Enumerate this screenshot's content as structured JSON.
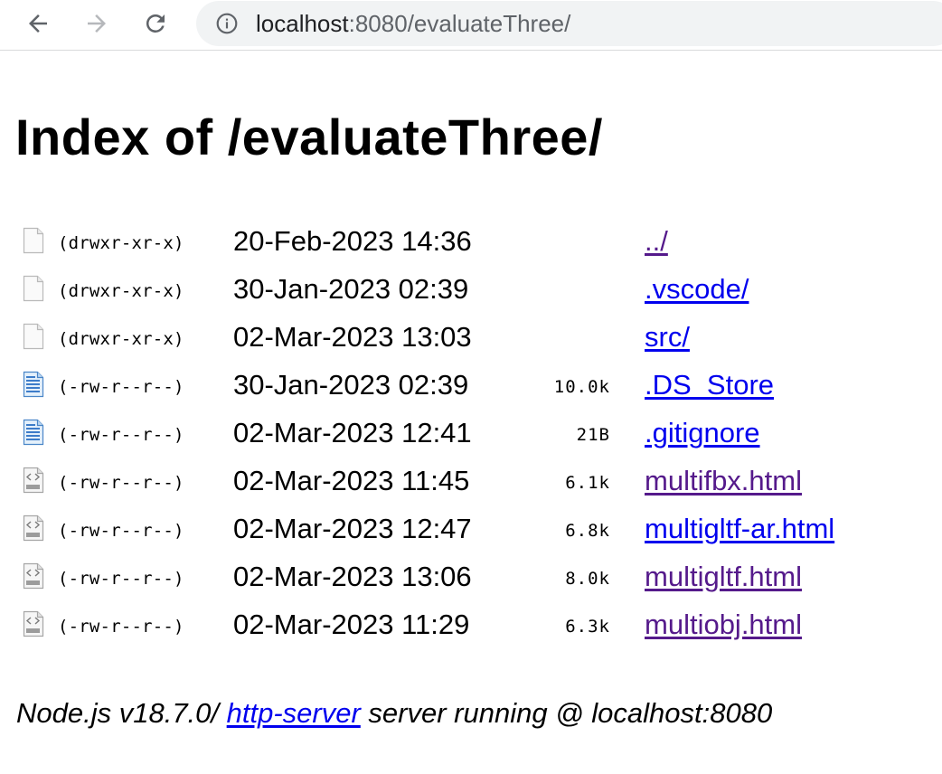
{
  "browser": {
    "url_host": "localhost",
    "url_rest": ":8080/evaluateThree/"
  },
  "page": {
    "title": "Index of /evaluateThree/"
  },
  "entries": [
    {
      "icon": "blank-file-icon",
      "perm": "(drwxr-xr-x)",
      "date": "20-Feb-2023 14:36",
      "size": "",
      "name": "../",
      "visited": true
    },
    {
      "icon": "blank-file-icon",
      "perm": "(drwxr-xr-x)",
      "date": "30-Jan-2023 02:39",
      "size": "",
      "name": ".vscode/",
      "visited": false
    },
    {
      "icon": "blank-file-icon",
      "perm": "(drwxr-xr-x)",
      "date": "02-Mar-2023 13:03",
      "size": "",
      "name": "src/",
      "visited": false
    },
    {
      "icon": "text-file-icon",
      "perm": "(-rw-r--r--)",
      "date": "30-Jan-2023 02:39",
      "size": "10.0k",
      "name": ".DS_Store",
      "visited": false
    },
    {
      "icon": "text-file-icon",
      "perm": "(-rw-r--r--)",
      "date": "02-Mar-2023 12:41",
      "size": "21B",
      "name": ".gitignore",
      "visited": false
    },
    {
      "icon": "html-file-icon",
      "perm": "(-rw-r--r--)",
      "date": "02-Mar-2023 11:45",
      "size": "6.1k",
      "name": "multifbx.html",
      "visited": true
    },
    {
      "icon": "html-file-icon",
      "perm": "(-rw-r--r--)",
      "date": "02-Mar-2023 12:47",
      "size": "6.8k",
      "name": "multigltf-ar.html",
      "visited": false
    },
    {
      "icon": "html-file-icon",
      "perm": "(-rw-r--r--)",
      "date": "02-Mar-2023 13:06",
      "size": "8.0k",
      "name": "multigltf.html",
      "visited": true
    },
    {
      "icon": "html-file-icon",
      "perm": "(-rw-r--r--)",
      "date": "02-Mar-2023 11:29",
      "size": "6.3k",
      "name": "multiobj.html",
      "visited": true
    }
  ],
  "footer": {
    "prefix": "Node.js v18.7.0/ ",
    "link": "http-server",
    "suffix": " server running @ localhost:8080"
  },
  "colors": {
    "link_unvisited": "#0000ee",
    "link_visited": "#551a8b",
    "omnibox_bg": "#f1f3f4"
  }
}
